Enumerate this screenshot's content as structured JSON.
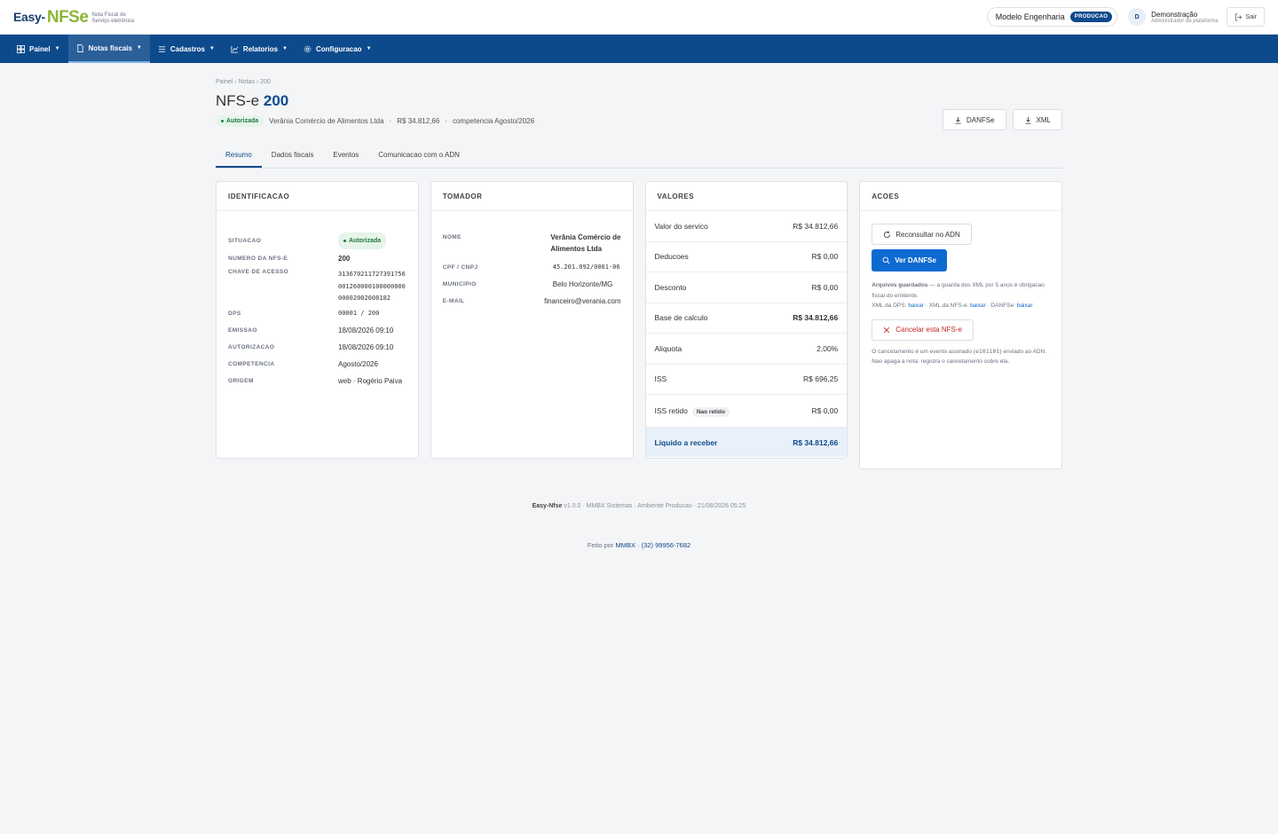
{
  "brand": {
    "easy": "Easy-",
    "nfse": "NFSe",
    "sub1": "Nota Fiscal de",
    "sub2": "Serviço eletrônica"
  },
  "header": {
    "company": "Modelo Engenharia",
    "env_badge": "PRODUCAO",
    "avatar_initial": "D",
    "user_name": "Demonstração",
    "user_role": "Administrador da plataforma",
    "logout": "Sair"
  },
  "nav": [
    {
      "label": "Painel",
      "icon": "grid-icon"
    },
    {
      "label": "Notas fiscais",
      "icon": "document-icon"
    },
    {
      "label": "Cadastros",
      "icon": "list-icon"
    },
    {
      "label": "Relatorios",
      "icon": "chart-icon"
    },
    {
      "label": "Configuracao",
      "icon": "gear-icon"
    }
  ],
  "breadcrumb": "Painel › Notas › 200",
  "page": {
    "title_prefix": "NFS-e",
    "title_number": "200",
    "status": "Autorizada",
    "company": "Verânia Comércio de Alimentos Ltda",
    "amount": "R$ 34.812,66",
    "competencia": "competencia Agosto/2026",
    "sep": "·",
    "btn_danfse": "DANFSe",
    "btn_xml": "XML"
  },
  "tabs": [
    "Resumo",
    "Dados fiscais",
    "Eventos",
    "Comunicacao com o ADN"
  ],
  "identificacao": {
    "title": "IDENTIFICACAO",
    "situacao_k": "SITUACAO",
    "situacao_v": "Autorizada",
    "numero_k": "NUMERO DA NFS-E",
    "numero_v": "200",
    "chave_k": "CHAVE DE ACESSO",
    "chave_l1": "313670211727391756",
    "chave_l2": "001260000100000000",
    "chave_l3": "00002002608182",
    "dps_k": "DPS",
    "dps_v": "00001 / 200",
    "emissao_k": "EMISSAO",
    "emissao_v": "18/08/2026 09:10",
    "autorizacao_k": "AUTORIZACAO",
    "autorizacao_v": "18/08/2026 09:10",
    "competencia_k": "COMPETENCIA",
    "competencia_v": "Agosto/2026",
    "origem_k": "ORIGEM",
    "origem_v": "web · Rogério Paiva"
  },
  "tomador": {
    "title": "TOMADOR",
    "nome_k": "NOME",
    "nome_l1": "Verânia Comércio de",
    "nome_l2": "Alimentos Ltda",
    "cpf_k": "CPF / CNPJ",
    "cpf_v": "45.201.092/0001-06",
    "municipio_k": "MUNICIPIO",
    "municipio_v": "Belo Horizonte/MG",
    "email_k": "E-MAIL",
    "email_v": "financeiro@verania.com"
  },
  "valores": {
    "title": "VALORES",
    "rows": [
      {
        "label": "Valor do servico",
        "value": "R$ 34.812,66"
      },
      {
        "label": "Deducoes",
        "value": "R$ 0,00"
      },
      {
        "label": "Desconto",
        "value": "R$ 0,00"
      },
      {
        "label": "Base de calculo",
        "value": "R$ 34.812,66"
      },
      {
        "label": "Aliquota",
        "value": "2,00%"
      },
      {
        "label": "ISS",
        "value": "R$ 696,25"
      },
      {
        "label": "ISS retido",
        "value": "R$ 0,00",
        "badge": "Nao retido"
      },
      {
        "label": "Liquido a receber",
        "value": "R$ 34.812,66"
      }
    ]
  },
  "acoes": {
    "title": "ACOES",
    "reconsultar": "Reconsultar no ADN",
    "ver_danfse": "Ver DANFSe",
    "note_bold": "Arquivos guardados",
    "note_text": " — a guarda dos XML por 5 anos é obrigacao fiscal do emitente.",
    "xml_dps": "XML da DPS: ",
    "xml_nfse": " · XML da NFS-e: ",
    "danfse": " · DANFSe: ",
    "baixar": "baixar",
    "cancelar": "Cancelar esta NFS-e",
    "cancel_note_1": "O cancelamento é um evento assinado (",
    "cancel_note_code": "e101101",
    "cancel_note_2": ") enviado ao ADN. Nao apaga a nota: registra o cancelamento sobre ela."
  },
  "footer": {
    "app": "Easy-Nfse",
    "rest": " v1.0.0 · MMBX Sistemas · Ambiente Producao · 21/08/2026 05:25",
    "made_by": "Feito por ",
    "company": "MMBX",
    "phone": " · (32) 99956-7682"
  },
  "colors": {
    "primary": "#0d4a8c",
    "accent": "#0d6ad1",
    "success": "#1f7a3d",
    "danger": "#c62828",
    "brand_green": "#8cb53a"
  }
}
